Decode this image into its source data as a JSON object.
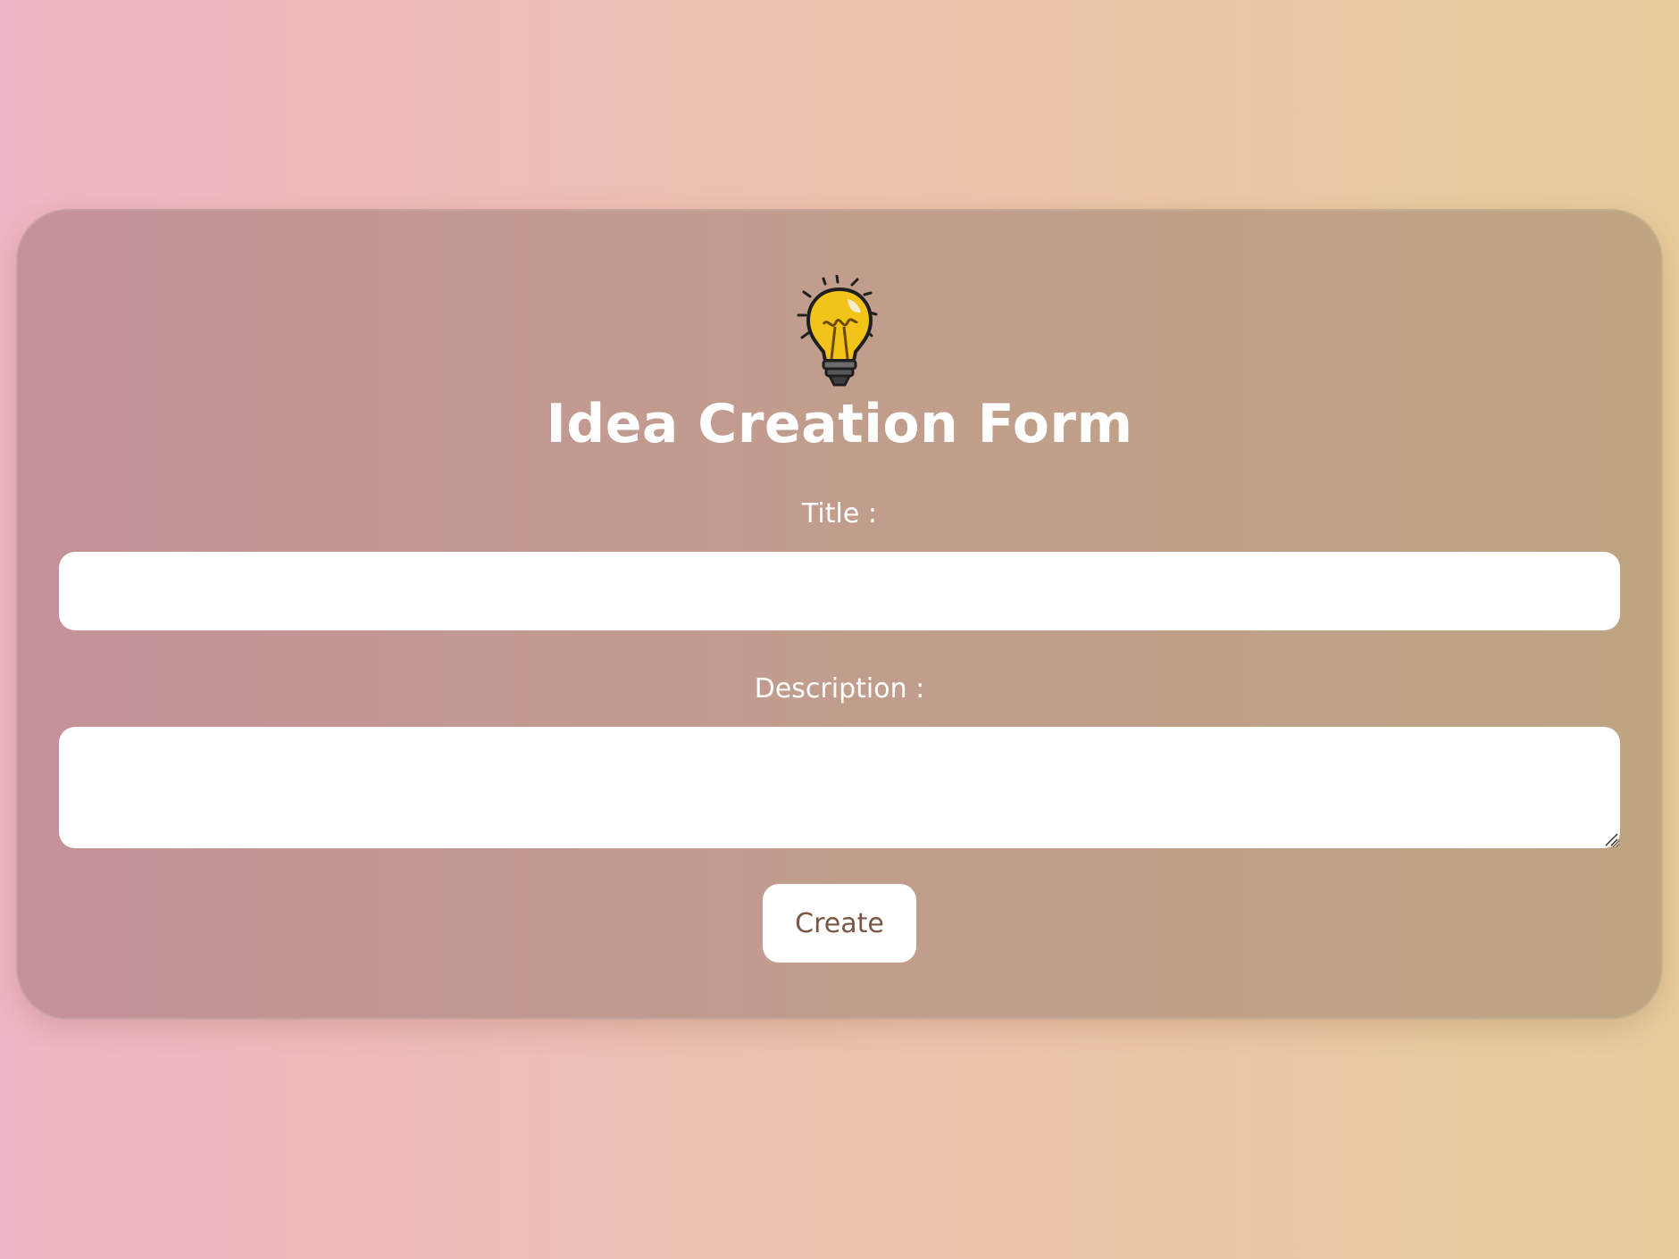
{
  "form": {
    "icon": "light-bulb-icon",
    "heading": "Idea Creation Form",
    "title_label": "Title :",
    "title_value": "",
    "description_label": "Description :",
    "description_value": "",
    "create_label": "Create"
  },
  "colors": {
    "background_left": "#efb5c4",
    "background_right": "#e8cc9c",
    "card_left": "#c49199",
    "card_right": "#bfa582",
    "text": "#ffffff",
    "button_text": "#7b5645",
    "bulb": "#f2c318"
  }
}
